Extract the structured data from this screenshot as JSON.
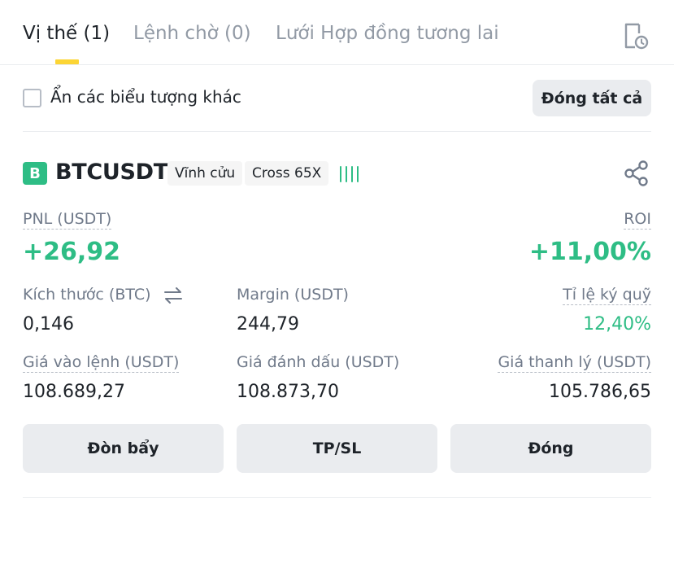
{
  "tabs": [
    {
      "label": "Vị thế (1)",
      "active": true
    },
    {
      "label": "Lệnh chờ (0)",
      "active": false
    },
    {
      "label": "Lưới Hợp đồng tương lai",
      "active": false
    }
  ],
  "icons": {
    "history": "history-icon",
    "share": "share-icon",
    "swap": "swap-icon"
  },
  "filter": {
    "hide_other_symbols_label": "Ẩn các biểu tượng khác",
    "checked": false,
    "close_all_label": "Đóng tất cả"
  },
  "position": {
    "side_badge": "B",
    "symbol": "BTCUSDT",
    "contract_type": "Vĩnh cửu",
    "margin_mode": "Cross 65X",
    "pnl_label": "PNL (USDT)",
    "pnl_value": "+26,92",
    "roi_label": "ROI",
    "roi_value": "+11,00%",
    "size_label": "Kích thước (BTC)",
    "size_value": "0,146",
    "margin_label": "Margin (USDT)",
    "margin_value": "244,79",
    "margin_ratio_label": "Tỉ lệ ký quỹ",
    "margin_ratio_value": "12,40%",
    "entry_price_label": "Giá vào lệnh (USDT)",
    "entry_price_value": "108.689,27",
    "mark_price_label": "Giá đánh dấu (USDT)",
    "mark_price_value": "108.873,70",
    "liq_price_label": "Giá thanh lý (USDT)",
    "liq_price_value": "105.786,65"
  },
  "actions": {
    "leverage_label": "Đòn bẩy",
    "tpsl_label": "TP/SL",
    "close_label": "Đóng"
  },
  "colors": {
    "profit": "#2ebd85",
    "accent": "#fcd535",
    "text_primary": "#1e2329",
    "text_secondary": "#707a8a",
    "button_bg": "#eaecef"
  }
}
